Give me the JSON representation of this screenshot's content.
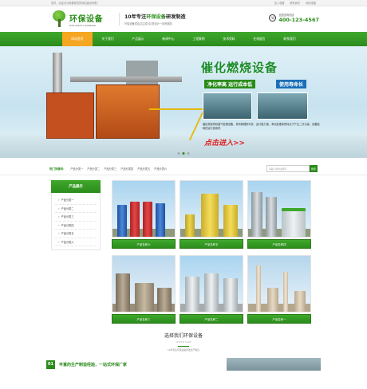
{
  "topbar": {
    "welcome": "您好，欢迎访问我要需您的网站建设有限！",
    "links": [
      "加入收藏",
      "联系我们",
      "网站地图"
    ]
  },
  "header": {
    "logo_cn": "环保设备",
    "logo_en": "WOLIANCE LEARNING",
    "slogan_prefix": "10年专注",
    "slogan_highlight": "环保设备",
    "slogan_suffix": "研发制造",
    "slogan_sub": "环保设备供应达达成(中)是设计一体完服务",
    "hotline_label": "全国咨询热线",
    "hotline_number": "400-123-4567"
  },
  "nav": {
    "items": [
      "网站首页",
      "关于我们",
      "产品展示",
      "新闻中心",
      "工程案例",
      "技术资料",
      "在线留言",
      "联系我们"
    ],
    "active_index": 0
  },
  "banner": {
    "title": "催化燃烧设备",
    "tag1": "净化率高 运行成本低",
    "tag2": "使用寿命长",
    "description": "催化燃烧有机废气处理设备，具有管理条件多，运行能力强，净化处理量的特点于产业二次污染，设备能耗低运行费用低",
    "cta": "点击进入>>",
    "dots": 3,
    "active_dot": 1
  },
  "hotbar": {
    "label": "热门关键词：",
    "items": [
      "产品分类一",
      "产品分类二",
      "产品分类三",
      "产品分类四",
      "产品分类五",
      "产品分类六"
    ],
    "search_placeholder": "请输入搜索关键字",
    "search_button": "搜索"
  },
  "sidebar": {
    "title": "产品展示",
    "items": [
      "产品分类一",
      "产品分类二",
      "产品分类三",
      "产品分类四",
      "产品分类五",
      "产品分类六"
    ]
  },
  "products": [
    {
      "name": "产品名称六"
    },
    {
      "name": "产品名称五"
    },
    {
      "name": "产品名称四"
    },
    {
      "name": "产品名称三"
    },
    {
      "name": "产品名称二"
    },
    {
      "name": "产品名称一"
    }
  ],
  "section": {
    "title": "选择我们环保设备",
    "en": "CHOICE CASE",
    "sub": "10年专注环保设备研发生产制造"
  },
  "advantage": {
    "num": "01",
    "text": "丰富的生产制造经验，一站式环保厂家"
  },
  "colors": {
    "brand_green": "#2a8c1a",
    "nav_active": "#f5a623",
    "cta_red": "#e02020"
  }
}
